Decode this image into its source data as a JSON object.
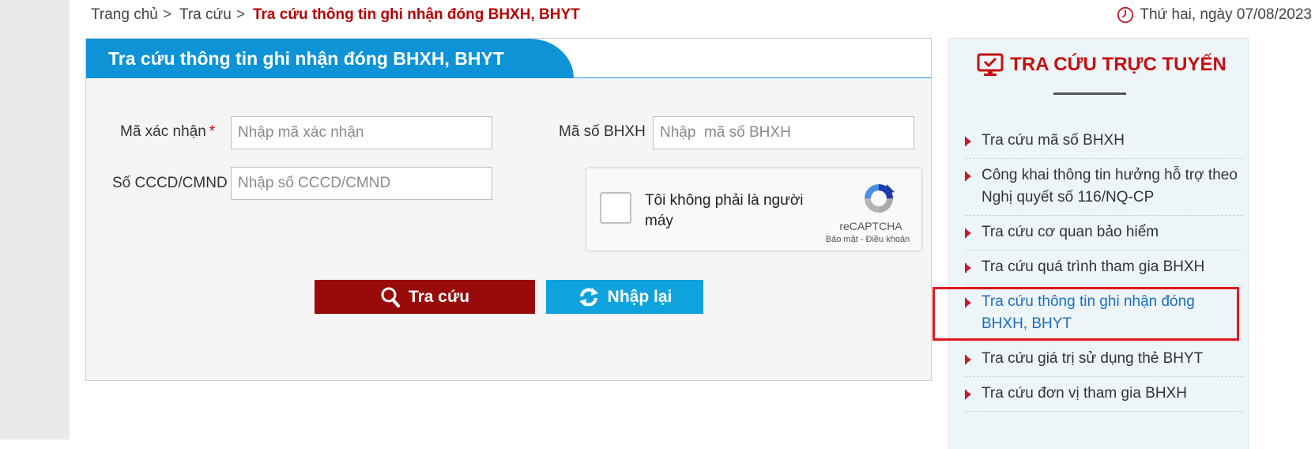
{
  "breadcrumb": {
    "home": "Trang chủ",
    "sep1": ">",
    "level2": "Tra cứu",
    "sep2": ">",
    "current": "Tra cứu thông tin ghi nhận đóng BHXH, BHYT"
  },
  "date_text": "Thứ hai, ngày 07/08/2023",
  "panel": {
    "title": "Tra cứu thông tin ghi nhận đóng BHXH, BHYT",
    "captcha_code_label": "Mã xác nhận",
    "required_mark": "*",
    "captcha_code_placeholder": "Nhập mã xác nhận",
    "bhxh_label": "Mã số BHXH",
    "bhxh_placeholder": "Nhập  mã số BHXH",
    "id_label": "Số CCCD/CMND",
    "id_placeholder": "Nhập số CCCD/CMND",
    "recaptcha": {
      "text": "Tôi không phải là người máy",
      "brand": "reCAPTCHA",
      "links": "Bảo mật - Điều khoản"
    },
    "search_button": "Tra cứu",
    "reset_button": "Nhập lại"
  },
  "sidebar": {
    "title": "TRA CỨU TRỰC TUYẾN",
    "items": [
      {
        "label": "Tra cứu mã số BHXH",
        "active": false
      },
      {
        "label": "Công khai thông tin hưởng hỗ trợ theo Nghị quyết số 116/NQ-CP",
        "active": false
      },
      {
        "label": "Tra cứu cơ quan bảo hiểm",
        "active": false
      },
      {
        "label": "Tra cứu quá trình tham gia BHXH",
        "active": false
      },
      {
        "label": "Tra cứu thông tin ghi nhận đóng BHXH, BHYT",
        "active": true
      },
      {
        "label": "Tra cứu giá trị sử dụng thẻ BHYT",
        "active": false
      },
      {
        "label": "Tra cứu đơn vị tham gia BHXH",
        "active": false
      }
    ]
  },
  "colors": {
    "accent_red": "#b80000",
    "header_blue": "#0d93d6",
    "search_button": "#990a0a",
    "reset_button": "#0fa3dd",
    "active_link": "#1a6fbf",
    "highlight_border": "#e0181e"
  },
  "icons": {
    "date": "clock-icon",
    "search_button": "search-icon",
    "reset_button": "refresh-icon",
    "sidebar_title": "monitor-check-icon",
    "list_bullet": "arrow-bullet-icon"
  }
}
